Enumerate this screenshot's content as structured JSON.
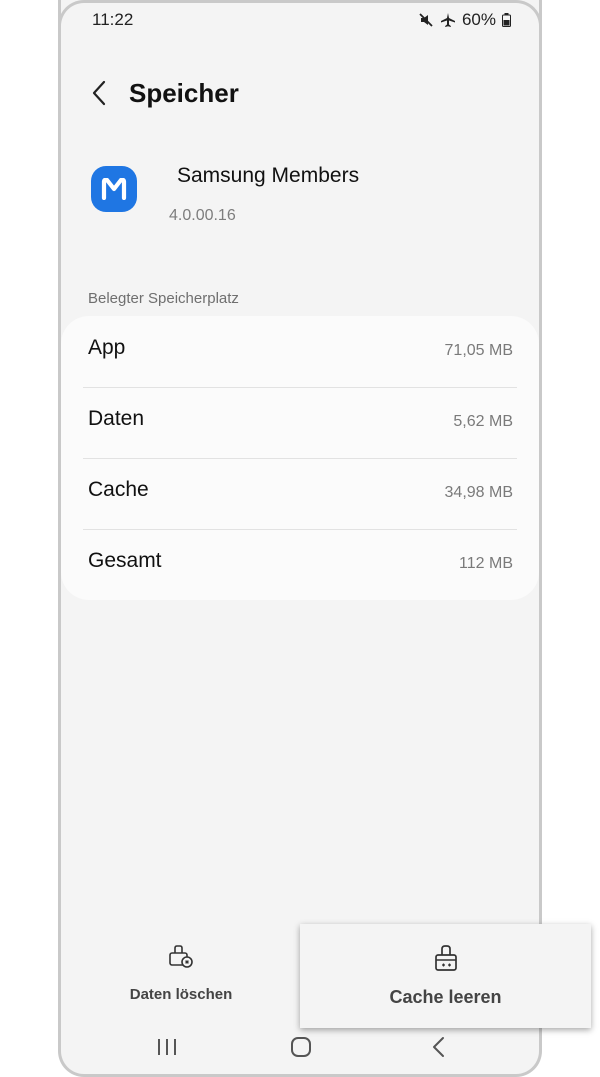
{
  "status_bar": {
    "time": "11:22",
    "battery": "60%",
    "icons": [
      "mute-icon",
      "airplane-mode-icon",
      "battery-charging-icon"
    ]
  },
  "header": {
    "title": "Speicher",
    "back_icon": "chevron-left-icon"
  },
  "app": {
    "name": "Samsung Members",
    "version": "4.0.00.16",
    "icon_letter": "M",
    "icon_color": "#1f76e3"
  },
  "storage": {
    "section_label": "Belegter Speicherplatz",
    "rows": [
      {
        "label": "App",
        "value": "71,05 MB"
      },
      {
        "label": "Daten",
        "value": "5,62 MB"
      },
      {
        "label": "Cache",
        "value": "34,98 MB"
      },
      {
        "label": "Gesamt",
        "value": "112 MB"
      }
    ]
  },
  "actions": {
    "clear_data": {
      "label": "Daten löschen",
      "icon": "clear-data-icon"
    },
    "clear_cache": {
      "label": "Cache leeren",
      "icon": "clear-cache-icon"
    }
  },
  "nav": {
    "recent_icon": "recent-apps-icon",
    "home_icon": "home-icon",
    "back_icon": "back-icon"
  }
}
